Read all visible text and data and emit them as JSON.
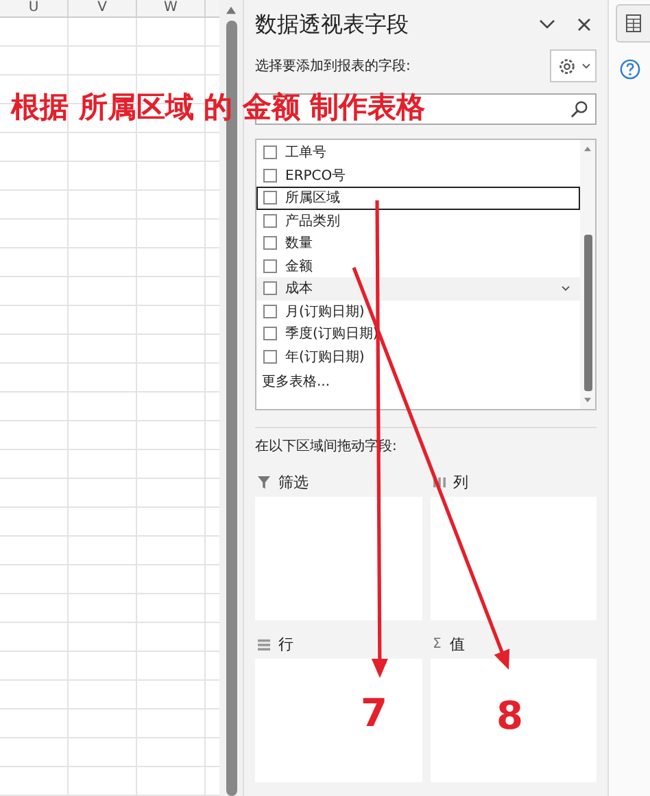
{
  "spreadsheet": {
    "columns": [
      "U",
      "V",
      "W"
    ]
  },
  "pane": {
    "title": "数据透视表字段",
    "prompt": "选择要添加到报表的字段:"
  },
  "fields": [
    {
      "label": "工单号",
      "checked": false,
      "focused": false,
      "hovered": false
    },
    {
      "label": "ERPCO号",
      "checked": false,
      "focused": false,
      "hovered": false
    },
    {
      "label": "所属区域",
      "checked": false,
      "focused": true,
      "hovered": false
    },
    {
      "label": "产品类别",
      "checked": false,
      "focused": false,
      "hovered": false
    },
    {
      "label": "数量",
      "checked": false,
      "focused": false,
      "hovered": false
    },
    {
      "label": "金额",
      "checked": false,
      "focused": false,
      "hovered": false
    },
    {
      "label": "成本",
      "checked": false,
      "focused": false,
      "hovered": true
    },
    {
      "label": "月(订购日期)",
      "checked": false,
      "focused": false,
      "hovered": false
    },
    {
      "label": "季度(订购日期)",
      "checked": false,
      "focused": false,
      "hovered": false
    },
    {
      "label": "年(订购日期)",
      "checked": false,
      "focused": false,
      "hovered": false
    }
  ],
  "more_tables": "更多表格...",
  "areas_prompt": "在以下区域间拖动字段:",
  "areas": [
    {
      "kind": "filter",
      "label": "筛选"
    },
    {
      "kind": "columns",
      "label": "列"
    },
    {
      "kind": "rows",
      "label": "行"
    },
    {
      "kind": "values",
      "label": "值",
      "symbol": "Σ"
    }
  ],
  "annotations": {
    "headline": "根据 所属区域 的 金额 制作表格",
    "arrows": [
      {
        "label": "7"
      },
      {
        "label": "8"
      }
    ]
  }
}
